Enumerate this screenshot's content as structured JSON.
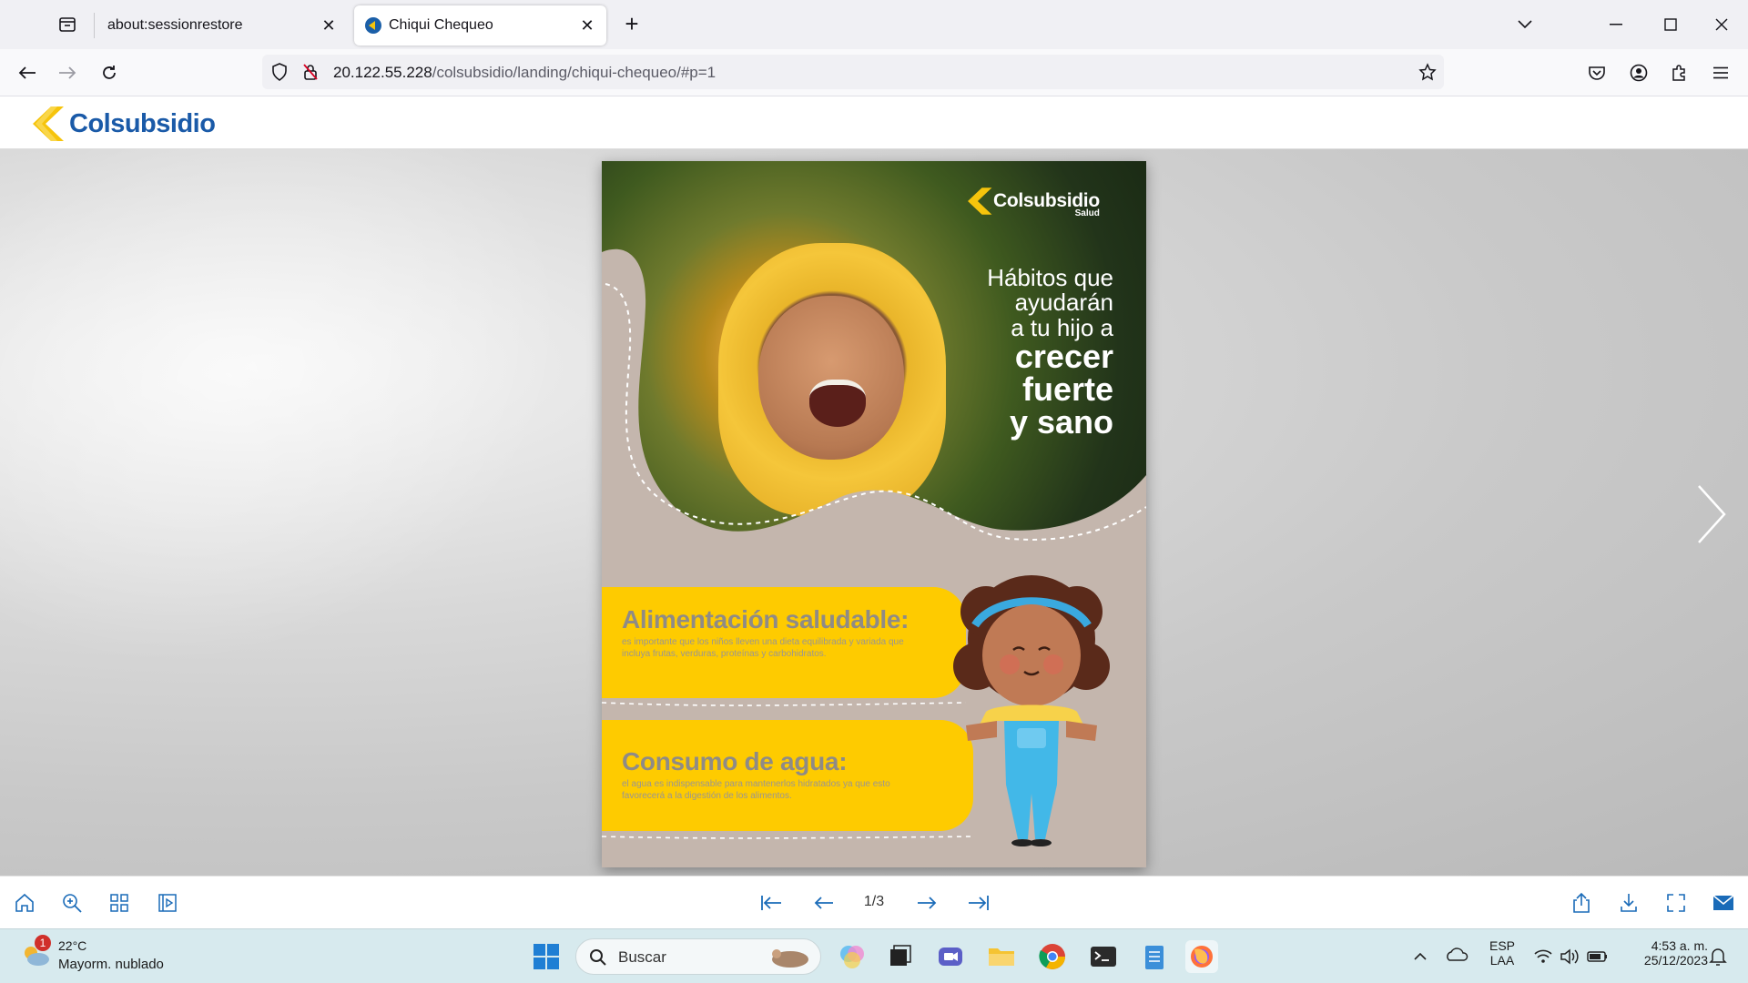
{
  "browser": {
    "tabs": [
      {
        "title": "about:sessionrestore",
        "active": false
      },
      {
        "title": "Chiqui Chequeo",
        "active": true
      }
    ],
    "url_host": "20.122.55.228",
    "url_path": "/colsubsidio/landing/chiqui-chequeo/#p=1",
    "icons": [
      "tab-list-icon",
      "close-icon",
      "new-tab-icon",
      "chevron-down-icon",
      "minimize-icon",
      "maximize-icon",
      "window-close-icon",
      "back-icon",
      "forward-icon",
      "reload-icon",
      "shield-icon",
      "insecure-lock-icon",
      "star-icon",
      "pocket-icon",
      "account-icon",
      "extensions-icon",
      "menu-icon"
    ]
  },
  "site": {
    "logo_text": "Colsubsidio",
    "brand_colors": {
      "blue": "#1a5aa8",
      "yellow": "#f6c40c"
    }
  },
  "flipbook": {
    "page": {
      "logo_name": "Colsubsidio",
      "logo_sub": "Salud",
      "headline_light": [
        "Hábitos que",
        "ayudarán",
        "a tu hijo a"
      ],
      "headline_bold": [
        "crecer",
        "fuerte",
        "y sano"
      ],
      "box1_title": "Alimentación saludable:",
      "box1_text": "es importante que los niños lleven una dieta equilibrada y variada que incluya frutas, verduras, proteínas y carbohidratos.",
      "box2_title": "Consumo de agua:",
      "box2_text": "el agua es indispensable para mantenerlos hidratados ya que esto favorecerá a la digestión de los alimentos.",
      "background_color": "#c4b6ad",
      "box_color": "#fecb00"
    },
    "page_indicator": "1/3",
    "toolbar_icons": [
      "home-icon",
      "zoom-in-icon",
      "thumbnails-icon",
      "slideshow-icon",
      "first-page-icon",
      "prev-page-icon",
      "next-page-icon",
      "last-page-icon",
      "share-icon",
      "download-icon",
      "fullscreen-icon",
      "email-icon"
    ]
  },
  "taskbar": {
    "weather_badge": "1",
    "weather_temp": "22°C",
    "weather_desc": "Mayorm. nublado",
    "search_label": "Buscar",
    "lang_top": "ESP",
    "lang_bottom": "LAA",
    "time": "4:53 a. m.",
    "date": "25/12/2023"
  }
}
